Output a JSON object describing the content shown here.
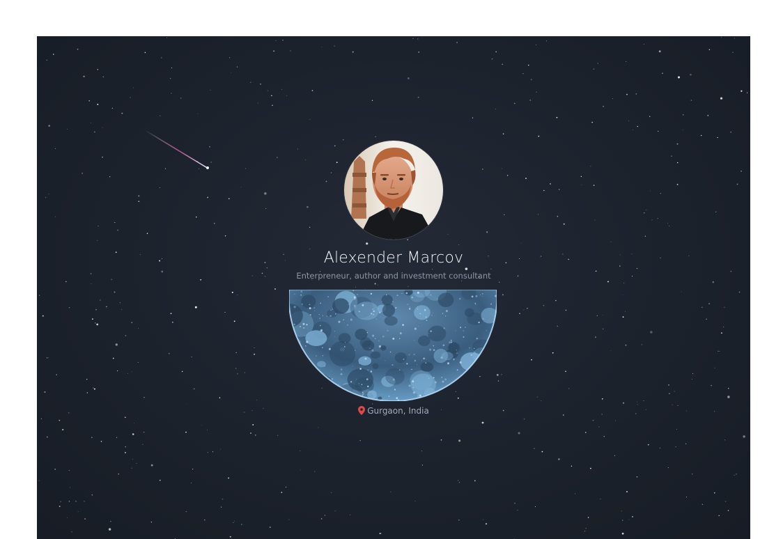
{
  "profile": {
    "name": "Alexender Marcov",
    "tagline": "Enterpreneur, author and investment consultant",
    "location": "Gurgaon, India",
    "avatar_icon": "portrait-photo",
    "location_icon": "map-pin-icon"
  },
  "colors": {
    "sky": "#1c222c",
    "name_text": "#f2f4f7",
    "tagline_text": "#8e96a3",
    "pin": "#e04848",
    "moon_highlight": "#a9d4f2"
  }
}
